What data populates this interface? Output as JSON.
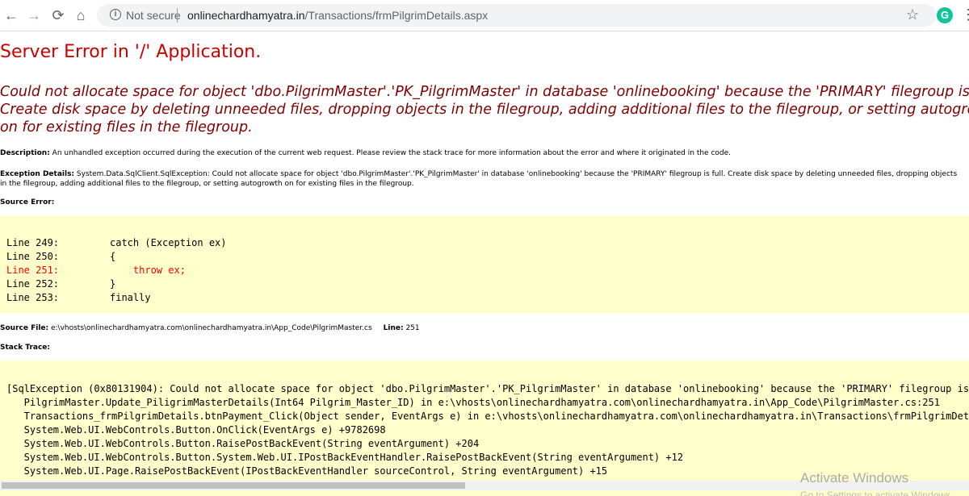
{
  "browser": {
    "back_glyph": "←",
    "forward_glyph": "→",
    "reload_glyph": "⟳",
    "home_glyph": "⌂",
    "info_glyph": "i",
    "security_label": "Not secure",
    "url_host": "onlinechardhamyatra.in",
    "url_path": "/Transactions/frmPilgrimDetails.aspx",
    "star_glyph": "☆",
    "extension_glyph": "G",
    "extension_color": "#15c39a",
    "menu_glyph": "⋮"
  },
  "error": {
    "title": "Server Error in '/' Application.",
    "message_lines": [
      "Could not allocate space for object 'dbo.PilgrimMaster'.'PK_PilgrimMaster' in database 'onlinebooking' because the 'PRIMARY' filegroup is full.",
      "Create disk space by deleting unneeded files, dropping objects in the filegroup, adding additional files to the filegroup, or setting autogrowth",
      "on for existing files in the filegroup."
    ],
    "description_label": "Description:",
    "description_text": " An unhandled exception occurred during the execution of the current web request. Please review the stack trace for more information about the error and where it originated in the code.",
    "exception_label": "Exception Details:",
    "exception_text": " System.Data.SqlClient.SqlException: Could not allocate space for object 'dbo.PilgrimMaster'.'PK_PilgrimMaster' in database 'onlinebooking' because the 'PRIMARY' filegroup is full. Create disk space by deleting unneeded files, dropping objects",
    "exception_text_line2": "in the filegroup, adding additional files to the filegroup, or setting autogrowth on for existing files in the filegroup.",
    "source_error_label": "Source Error:",
    "code_lines": [
      {
        "label": "Line 249:",
        "code": "catch (Exception ex)"
      },
      {
        "label": "Line 250:",
        "code": "{"
      },
      {
        "label": "Line 251:",
        "code": "    throw ex;"
      },
      {
        "label": "Line 252:",
        "code": "}"
      },
      {
        "label": "Line 253:",
        "code": "finally"
      }
    ],
    "source_file_label": "Source File:",
    "source_file_path": " e:\\vhosts\\onlinechardhamyatra.com\\onlinechardhamyatra.in\\App_Code\\PilgrimMaster.cs",
    "line_label": "Line:",
    "line_number": " 251",
    "stack_trace_label": "Stack Trace:",
    "stack_lines": [
      "[SqlException (0x80131904): Could not allocate space for object 'dbo.PilgrimMaster'.'PK_PilgrimMaster' in database 'onlinebooking' because the 'PRIMARY' filegroup is full.",
      "   PilgrimMaster.Update_PiligrimMasterDetails(Int64 Pilgrim_Master_ID) in e:\\vhosts\\onlinechardhamyatra.com\\onlinechardhamyatra.in\\App_Code\\PilgrimMaster.cs:251",
      "   Transactions_frmPilgrimDetails.btnPayment_Click(Object sender, EventArgs e) in e:\\vhosts\\onlinechardhamyatra.com\\onlinechardhamyatra.in\\Transactions\\frmPilgrimDetails.aspx.cs",
      "   System.Web.UI.WebControls.Button.OnClick(EventArgs e) +9782698",
      "   System.Web.UI.WebControls.Button.RaisePostBackEvent(String eventArgument) +204",
      "   System.Web.UI.WebControls.Button.System.Web.UI.IPostBackEventHandler.RaisePostBackEvent(String eventArgument) +12",
      "   System.Web.UI.Page.RaisePostBackEvent(IPostBackEventHandler sourceControl, String eventArgument) +15"
    ]
  },
  "watermark": {
    "title": "Activate Windows",
    "subtitle": "Go to Settings to activate Windows."
  }
}
